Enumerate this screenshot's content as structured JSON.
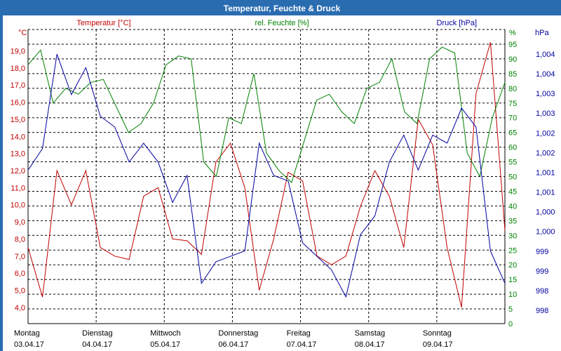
{
  "window": {
    "title": "Temperatur, Feuchte & Druck"
  },
  "colors": {
    "temperature": "#c00000",
    "humidity": "#008000",
    "pressure": "#0000a0",
    "title_bg": "#2a6cb0",
    "grid": "#000000"
  },
  "chart_data": {
    "type": "line",
    "legend": {
      "temperature": "Temperatur [°C]",
      "humidity": "rel. Feuchte [%]",
      "pressure": "Druck [hPa]"
    },
    "axes": {
      "left_unit": "°C",
      "right1_unit": "%",
      "right2_unit": "hPa",
      "left_ticks": [
        "19,0",
        "18,0",
        "17,0",
        "16,0",
        "15,0",
        "14,0",
        "13,0",
        "12,0",
        "11,0",
        "10,0",
        "9,0",
        "8,0",
        "7,0",
        "6,0",
        "5,0",
        "4,0"
      ],
      "right1_ticks": [
        "95",
        "90",
        "85",
        "80",
        "75",
        "70",
        "65",
        "60",
        "55",
        "50",
        "45",
        "40",
        "35",
        "30",
        "25",
        "20",
        "15",
        "10",
        "5",
        "0"
      ],
      "right2_ticks": [
        "1,004",
        "1,004",
        "1,003",
        "1,003",
        "1,002",
        "1,002",
        "1,001",
        "1,001",
        "1,000",
        "1,000",
        "999",
        "999",
        "998",
        "998"
      ],
      "temp_range": [
        3.05,
        20.25
      ],
      "hum_range": [
        0,
        100
      ],
      "x_days": [
        {
          "day": "Montag",
          "date": "03.04.17"
        },
        {
          "day": "Dienstag",
          "date": "04.04.17"
        },
        {
          "day": "Mittwoch",
          "date": "05.04.17"
        },
        {
          "day": "Donnerstag",
          "date": "06.04.17"
        },
        {
          "day": "Freitag",
          "date": "07.04.17"
        },
        {
          "day": "Samstag",
          "date": "08.04.17"
        },
        {
          "day": "Sonntag",
          "date": "09.04.17"
        }
      ]
    },
    "x_hours": [
      0,
      6,
      12,
      18,
      24,
      30,
      36,
      42,
      48,
      54,
      60,
      66,
      72,
      78,
      84,
      90,
      96,
      102,
      108,
      114,
      120,
      126,
      132,
      138,
      144,
      150,
      156,
      162,
      168
    ],
    "series": [
      {
        "name": "Temperatur [°C]",
        "color": "#c00000",
        "values": [
          7.5,
          4.6,
          12.0,
          10.0,
          12.0,
          7.5,
          7.0,
          6.8,
          10.5,
          11.0,
          8.0,
          7.9,
          7.1,
          12.5,
          13.6,
          11.0,
          5.0,
          8.0,
          11.9,
          11.4,
          7.0,
          6.5,
          7.0,
          9.9,
          12.0,
          10.5,
          7.5,
          15.0,
          13.5,
          7.5,
          4.0,
          16.5,
          19.5,
          8.5
        ]
      },
      {
        "name": "rel. Feuchte [%]",
        "color": "#008000",
        "values": [
          88,
          93,
          75,
          80,
          78,
          82,
          83,
          74,
          65,
          68,
          75,
          88,
          91,
          90,
          55,
          50,
          70,
          68,
          85,
          58,
          52,
          48,
          62,
          76,
          78,
          72,
          68,
          80,
          82,
          90,
          72,
          68,
          90,
          94,
          92,
          58,
          50,
          70,
          82
        ]
      },
      {
        "name": "Druck [hPa]",
        "color": "#0000a0",
        "values": [
          52,
          60,
          95,
          80,
          90,
          72,
          68,
          55,
          62,
          55,
          40,
          50,
          10,
          18,
          20,
          22,
          62,
          50,
          48,
          25,
          20,
          15,
          5,
          28,
          35,
          55,
          65,
          52,
          65,
          62,
          75,
          68,
          22,
          10
        ]
      }
    ]
  }
}
